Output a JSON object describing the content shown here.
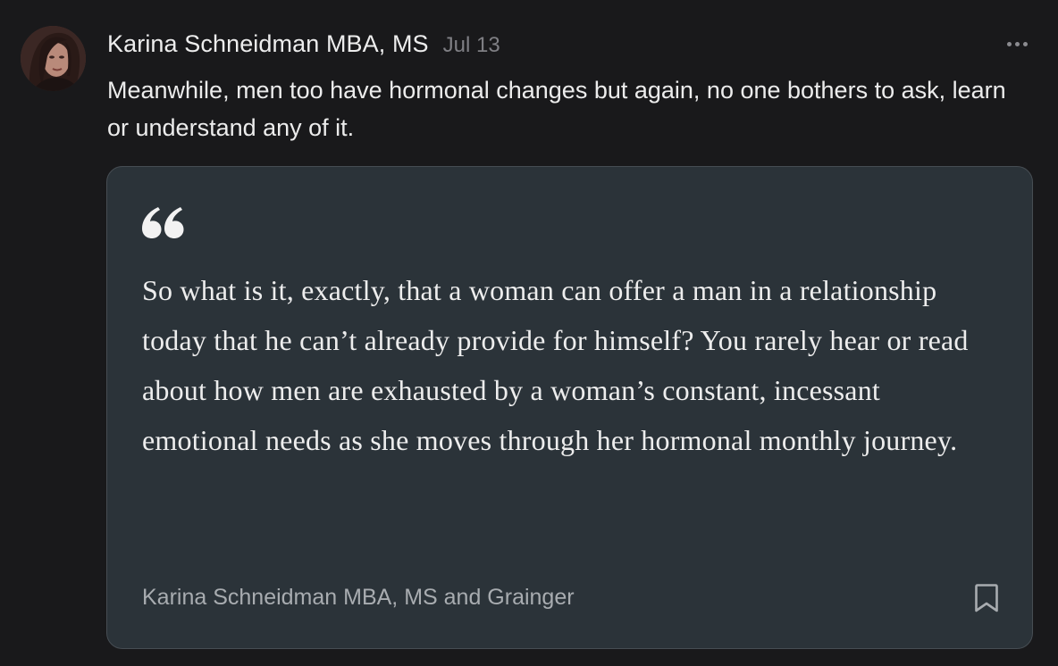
{
  "comment": {
    "author": "Karina Schneidman MBA, MS",
    "date": "Jul 13",
    "text": "Meanwhile, men too have hormonal changes but again, no one bothers to ask, learn or understand any of it.",
    "avatar_icon": "user-photo-avatar",
    "more_icon": "ellipsis-icon"
  },
  "quote": {
    "text": "So what is it, exactly, that a woman can offer a man in a relationship today that he can’t already provide for himself? You rarely hear or read about how men are exhausted by a woman’s constant, incessant emotional needs as she moves through her hormonal monthly journey.",
    "attribution": "Karina Schneidman MBA, MS and Grainger",
    "quote_icon": "quotation-mark-icon",
    "bookmark_icon": "bookmark-icon"
  },
  "colors": {
    "background": "#19191b",
    "card_background": "#2b3339",
    "card_border": "#464d53",
    "primary_text": "#ececec",
    "muted_text": "#7f7f84",
    "attribution_text": "#a8acb0"
  }
}
